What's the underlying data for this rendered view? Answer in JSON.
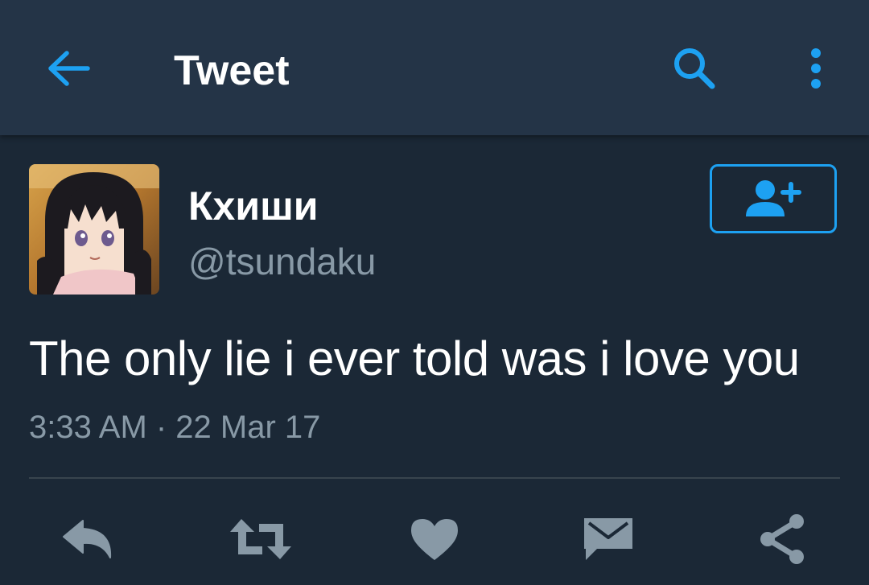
{
  "header": {
    "title": "Tweet",
    "back_icon": "arrow-left-icon",
    "search_icon": "search-icon",
    "more_icon": "more-vertical-icon",
    "accent_color": "#1da1f2"
  },
  "tweet": {
    "author": {
      "display_name": "Кхиши",
      "handle": "@tsundaku",
      "avatar": "avatar-image"
    },
    "follow_icon": "follow-user-icon",
    "text": "The only lie i ever told was i love you",
    "timestamp": "3:33 AM · 22 Mar 17"
  },
  "actions": [
    {
      "icon": "reply-icon"
    },
    {
      "icon": "retweet-icon"
    },
    {
      "icon": "heart-icon"
    },
    {
      "icon": "direct-message-icon"
    },
    {
      "icon": "share-icon"
    }
  ],
  "colors": {
    "background": "#1b2836",
    "header_background": "#243447",
    "secondary_text": "#8899a6",
    "action_icon": "#8899a6"
  }
}
